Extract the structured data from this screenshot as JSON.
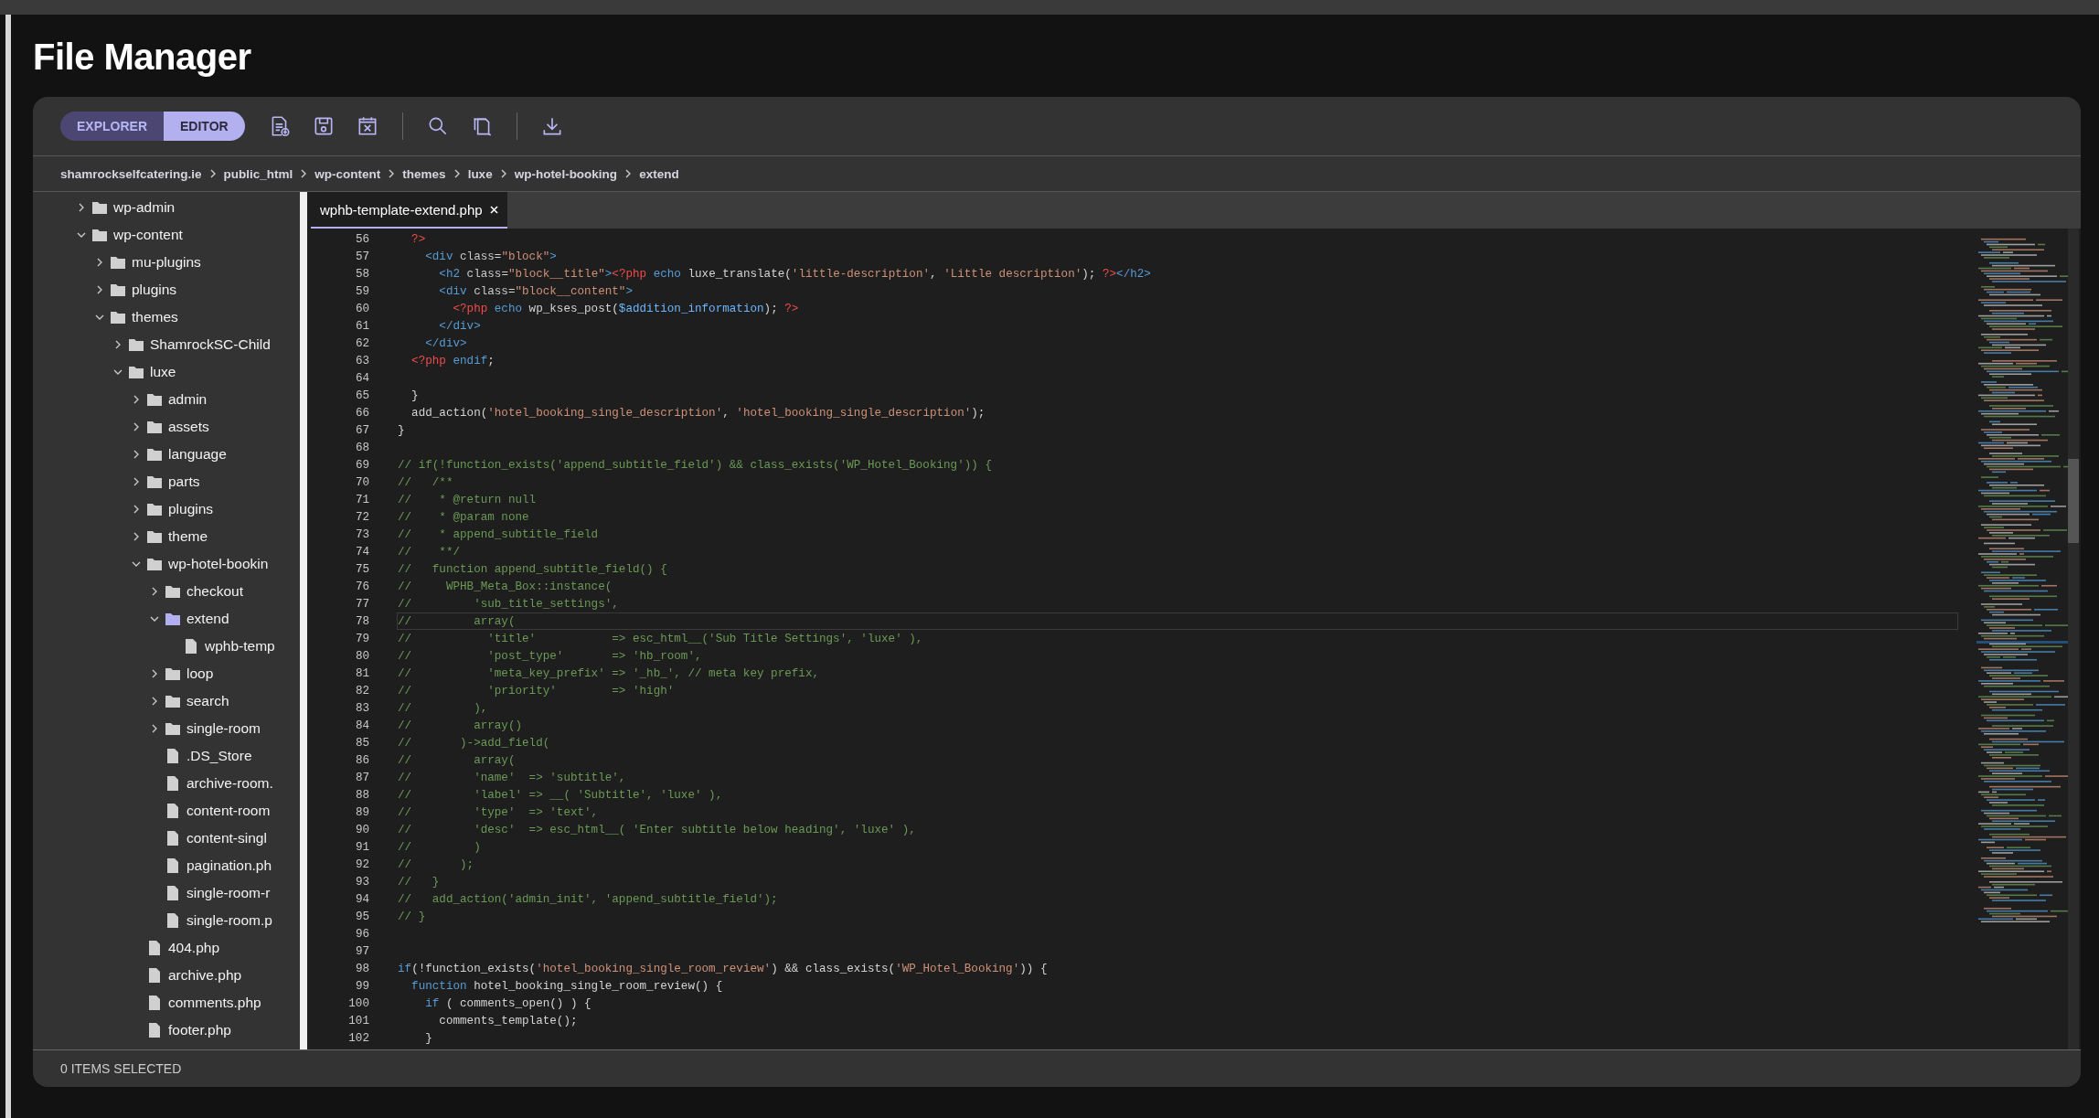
{
  "page_title": "File Manager",
  "view_switch": [
    {
      "label": "EXPLORER",
      "selected": false
    },
    {
      "label": "EDITOR",
      "selected": true
    }
  ],
  "breadcrumb": [
    "shamrockselfcatering.ie",
    "public_html",
    "wp-content",
    "themes",
    "luxe",
    "wp-hotel-booking",
    "extend"
  ],
  "tree": [
    {
      "name": "wp-admin",
      "kind": "folder",
      "expanded": false,
      "selected": false
    },
    {
      "name": "wp-content",
      "kind": "folder",
      "expanded": true,
      "selected": false,
      "children": [
        {
          "name": "mu-plugins",
          "kind": "folder",
          "expanded": false,
          "selected": false
        },
        {
          "name": "plugins",
          "kind": "folder",
          "expanded": false,
          "selected": false
        },
        {
          "name": "themes",
          "kind": "folder",
          "expanded": true,
          "selected": false,
          "children": [
            {
              "name": "ShamrockSC-Child",
              "kind": "folder",
              "expanded": false,
              "selected": false
            },
            {
              "name": "luxe",
              "kind": "folder",
              "expanded": true,
              "selected": false,
              "children": [
                {
                  "name": "admin",
                  "kind": "folder",
                  "expanded": false,
                  "selected": false
                },
                {
                  "name": "assets",
                  "kind": "folder",
                  "expanded": false,
                  "selected": false
                },
                {
                  "name": "language",
                  "kind": "folder",
                  "expanded": false,
                  "selected": false
                },
                {
                  "name": "parts",
                  "kind": "folder",
                  "expanded": false,
                  "selected": false
                },
                {
                  "name": "plugins",
                  "kind": "folder",
                  "expanded": false,
                  "selected": false
                },
                {
                  "name": "theme",
                  "kind": "folder",
                  "expanded": false,
                  "selected": false
                },
                {
                  "name": "wp-hotel-bookin",
                  "kind": "folder",
                  "expanded": true,
                  "selected": false,
                  "children": [
                    {
                      "name": "checkout",
                      "kind": "folder",
                      "expanded": false,
                      "selected": false
                    },
                    {
                      "name": "extend",
                      "kind": "folder",
                      "expanded": true,
                      "selected": true,
                      "children": [
                        {
                          "name": "wphb-temp",
                          "kind": "file",
                          "selected": false
                        }
                      ]
                    },
                    {
                      "name": "loop",
                      "kind": "folder",
                      "expanded": false,
                      "selected": false
                    },
                    {
                      "name": "search",
                      "kind": "folder",
                      "expanded": false,
                      "selected": false
                    },
                    {
                      "name": "single-room",
                      "kind": "folder",
                      "expanded": false,
                      "selected": false
                    },
                    {
                      "name": ".DS_Store",
                      "kind": "file",
                      "selected": false
                    },
                    {
                      "name": "archive-room.",
                      "kind": "file",
                      "selected": false
                    },
                    {
                      "name": "content-room",
                      "kind": "file",
                      "selected": false
                    },
                    {
                      "name": "content-singl",
                      "kind": "file",
                      "selected": false
                    },
                    {
                      "name": "pagination.ph",
                      "kind": "file",
                      "selected": false
                    },
                    {
                      "name": "single-room-r",
                      "kind": "file",
                      "selected": false
                    },
                    {
                      "name": "single-room.p",
                      "kind": "file",
                      "selected": false
                    }
                  ]
                },
                {
                  "name": "404.php",
                  "kind": "file",
                  "selected": false
                },
                {
                  "name": "archive.php",
                  "kind": "file",
                  "selected": false
                },
                {
                  "name": "comments.php",
                  "kind": "file",
                  "selected": false
                },
                {
                  "name": "footer.php",
                  "kind": "file",
                  "selected": false
                }
              ]
            }
          ]
        }
      ]
    }
  ],
  "editor": {
    "tabs": [
      {
        "label": "wphb-template-extend.php",
        "selected": true
      }
    ],
    "lines": [
      {
        "number": "56",
        "active": false,
        "tokens": [
          {
            "kind": "php",
            "text": "  ?>"
          }
        ]
      },
      {
        "number": "57",
        "active": false,
        "tokens": [
          {
            "kind": "tag",
            "text": "    <div"
          },
          {
            "kind": "attr",
            "text": " class"
          },
          {
            "kind": "plain",
            "text": "="
          },
          {
            "kind": "string",
            "text": "\"block\""
          },
          {
            "kind": "tag",
            "text": ">"
          }
        ]
      },
      {
        "number": "58",
        "active": false,
        "tokens": [
          {
            "kind": "tag",
            "text": "      <h2"
          },
          {
            "kind": "attr",
            "text": " class"
          },
          {
            "kind": "plain",
            "text": "="
          },
          {
            "kind": "string",
            "text": "\"block__title\""
          },
          {
            "kind": "tag",
            "text": ">"
          },
          {
            "kind": "php",
            "text": "<?php"
          },
          {
            "kind": "keyword",
            "text": " echo"
          },
          {
            "kind": "plain",
            "text": " luxe_translate("
          },
          {
            "kind": "string",
            "text": "'little-description'"
          },
          {
            "kind": "plain",
            "text": ", "
          },
          {
            "kind": "string",
            "text": "'Little description'"
          },
          {
            "kind": "plain",
            "text": "); "
          },
          {
            "kind": "php",
            "text": "?>"
          },
          {
            "kind": "tag",
            "text": "</h2>"
          }
        ]
      },
      {
        "number": "59",
        "active": false,
        "tokens": [
          {
            "kind": "tag",
            "text": "      <div"
          },
          {
            "kind": "attr",
            "text": " class"
          },
          {
            "kind": "plain",
            "text": "="
          },
          {
            "kind": "string",
            "text": "\"block__content\""
          },
          {
            "kind": "tag",
            "text": ">"
          }
        ]
      },
      {
        "number": "60",
        "active": false,
        "tokens": [
          {
            "kind": "php",
            "text": "        <?php"
          },
          {
            "kind": "keyword",
            "text": " echo"
          },
          {
            "kind": "plain",
            "text": " wp_kses_post("
          },
          {
            "kind": "variable",
            "text": "$addition_information"
          },
          {
            "kind": "plain",
            "text": "); "
          },
          {
            "kind": "php",
            "text": "?>"
          }
        ]
      },
      {
        "number": "61",
        "active": false,
        "tokens": [
          {
            "kind": "tag",
            "text": "      </div>"
          }
        ]
      },
      {
        "number": "62",
        "active": false,
        "tokens": [
          {
            "kind": "tag",
            "text": "    </div>"
          }
        ]
      },
      {
        "number": "63",
        "active": false,
        "tokens": [
          {
            "kind": "php",
            "text": "  <?php"
          },
          {
            "kind": "keyword",
            "text": " endif"
          },
          {
            "kind": "plain",
            "text": ";"
          }
        ]
      },
      {
        "number": "64",
        "active": false
      },
      {
        "number": "65",
        "active": false,
        "tokens": [
          {
            "kind": "plain",
            "text": "  }"
          }
        ]
      },
      {
        "number": "66",
        "active": false,
        "tokens": [
          {
            "kind": "plain",
            "text": "  add_action("
          },
          {
            "kind": "string",
            "text": "'hotel_booking_single_description'"
          },
          {
            "kind": "plain",
            "text": ", "
          },
          {
            "kind": "string",
            "text": "'hotel_booking_single_description'"
          },
          {
            "kind": "plain",
            "text": ");"
          }
        ]
      },
      {
        "number": "67",
        "active": false,
        "tokens": [
          {
            "kind": "plain",
            "text": "}"
          }
        ]
      },
      {
        "number": "68",
        "active": false
      },
      {
        "number": "69",
        "active": false,
        "tokens": [
          {
            "kind": "comment",
            "text": "// if(!function_exists('append_subtitle_field') && class_exists('WP_Hotel_Booking')) {"
          }
        ]
      },
      {
        "number": "70",
        "active": false,
        "tokens": [
          {
            "kind": "comment",
            "text": "//   /**"
          }
        ]
      },
      {
        "number": "71",
        "active": false,
        "tokens": [
          {
            "kind": "comment",
            "text": "//    * @return null"
          }
        ]
      },
      {
        "number": "72",
        "active": false,
        "tokens": [
          {
            "kind": "comment",
            "text": "//    * @param none"
          }
        ]
      },
      {
        "number": "73",
        "active": false,
        "tokens": [
          {
            "kind": "comment",
            "text": "//    * append_subtitle_field"
          }
        ]
      },
      {
        "number": "74",
        "active": false,
        "tokens": [
          {
            "kind": "comment",
            "text": "//    **/"
          }
        ]
      },
      {
        "number": "75",
        "active": false,
        "tokens": [
          {
            "kind": "comment",
            "text": "//   function append_subtitle_field() {"
          }
        ]
      },
      {
        "number": "76",
        "active": false,
        "tokens": [
          {
            "kind": "comment",
            "text": "//     WPHB_Meta_Box::instance("
          }
        ]
      },
      {
        "number": "77",
        "active": false,
        "tokens": [
          {
            "kind": "comment",
            "text": "//         'sub_title_settings',"
          }
        ]
      },
      {
        "number": "78",
        "active": true,
        "tokens": [
          {
            "kind": "comment",
            "text": "//         array("
          }
        ]
      },
      {
        "number": "79",
        "active": false,
        "tokens": [
          {
            "kind": "comment",
            "text": "//           'title'           => esc_html__('Sub Title Settings', 'luxe' ),"
          }
        ]
      },
      {
        "number": "80",
        "active": false,
        "tokens": [
          {
            "kind": "comment",
            "text": "//           'post_type'       => 'hb_room',"
          }
        ]
      },
      {
        "number": "81",
        "active": false,
        "tokens": [
          {
            "kind": "comment",
            "text": "//           'meta_key_prefix' => '_hb_', // meta key prefix,"
          }
        ]
      },
      {
        "number": "82",
        "active": false,
        "tokens": [
          {
            "kind": "comment",
            "text": "//           'priority'        => 'high'"
          }
        ]
      },
      {
        "number": "83",
        "active": false,
        "tokens": [
          {
            "kind": "comment",
            "text": "//         ),"
          }
        ]
      },
      {
        "number": "84",
        "active": false,
        "tokens": [
          {
            "kind": "comment",
            "text": "//         array()"
          }
        ]
      },
      {
        "number": "85",
        "active": false,
        "tokens": [
          {
            "kind": "comment",
            "text": "//       )->add_field("
          }
        ]
      },
      {
        "number": "86",
        "active": false,
        "tokens": [
          {
            "kind": "comment",
            "text": "//         array("
          }
        ]
      },
      {
        "number": "87",
        "active": false,
        "tokens": [
          {
            "kind": "comment",
            "text": "//         'name'  => 'subtitle',"
          }
        ]
      },
      {
        "number": "88",
        "active": false,
        "tokens": [
          {
            "kind": "comment",
            "text": "//         'label' => __( 'Subtitle', 'luxe' ),"
          }
        ]
      },
      {
        "number": "89",
        "active": false,
        "tokens": [
          {
            "kind": "comment",
            "text": "//         'type'  => 'text',"
          }
        ]
      },
      {
        "number": "90",
        "active": false,
        "tokens": [
          {
            "kind": "comment",
            "text": "//         'desc'  => esc_html__( 'Enter subtitle below heading', 'luxe' ),"
          }
        ]
      },
      {
        "number": "91",
        "active": false,
        "tokens": [
          {
            "kind": "comment",
            "text": "//         )"
          }
        ]
      },
      {
        "number": "92",
        "active": false,
        "tokens": [
          {
            "kind": "comment",
            "text": "//       );"
          }
        ]
      },
      {
        "number": "93",
        "active": false,
        "tokens": [
          {
            "kind": "comment",
            "text": "//   }"
          }
        ]
      },
      {
        "number": "94",
        "active": false,
        "tokens": [
          {
            "kind": "comment",
            "text": "//   add_action('admin_init', 'append_subtitle_field');"
          }
        ]
      },
      {
        "number": "95",
        "active": false,
        "tokens": [
          {
            "kind": "comment",
            "text": "// }"
          }
        ]
      },
      {
        "number": "96",
        "active": false
      },
      {
        "number": "97",
        "active": false
      },
      {
        "number": "98",
        "active": false,
        "tokens": [
          {
            "kind": "keyword",
            "text": "if"
          },
          {
            "kind": "plain",
            "text": "(!function_exists("
          },
          {
            "kind": "string",
            "text": "'hotel_booking_single_room_review'"
          },
          {
            "kind": "plain",
            "text": ") && class_exists("
          },
          {
            "kind": "string",
            "text": "'WP_Hotel_Booking'"
          },
          {
            "kind": "plain",
            "text": ")) {"
          }
        ]
      },
      {
        "number": "99",
        "active": false,
        "tokens": [
          {
            "kind": "keyword",
            "text": "  function"
          },
          {
            "kind": "plain",
            "text": " hotel_booking_single_room_review() {"
          }
        ]
      },
      {
        "number": "100",
        "active": false,
        "tokens": [
          {
            "kind": "keyword",
            "text": "    if"
          },
          {
            "kind": "plain",
            "text": " ( comments_open() ) {"
          }
        ]
      },
      {
        "number": "101",
        "active": false,
        "tokens": [
          {
            "kind": "plain",
            "text": "      comments_template();"
          }
        ]
      },
      {
        "number": "102",
        "active": false,
        "tokens": [
          {
            "kind": "plain",
            "text": "    }"
          }
        ]
      }
    ]
  },
  "status_bar": "0 ITEMS SELECTED"
}
